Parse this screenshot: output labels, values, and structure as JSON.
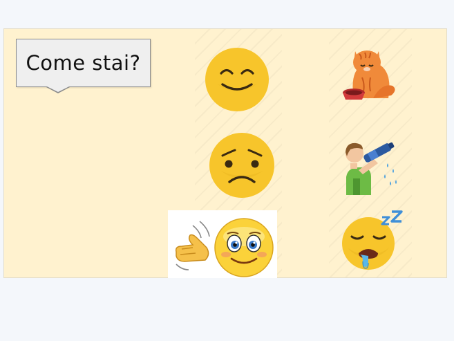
{
  "bubble": {
    "text": "Come stai?"
  },
  "icons": [
    "smiling-face-icon",
    "cat-eating-icon",
    "sad-face-icon",
    "man-drinking-icon",
    "waving-face-icon",
    "sleeping-face-icon"
  ],
  "colors": {
    "slide_background": "#fff2cf",
    "emoji_yellow": "#f7c52b",
    "bubble_fill": "#efefef"
  }
}
